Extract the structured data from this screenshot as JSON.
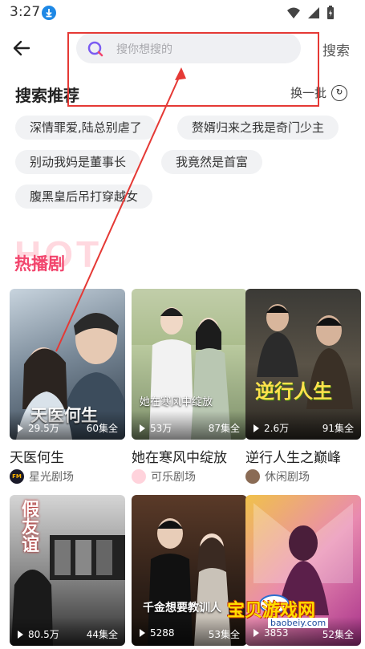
{
  "status_bar": {
    "time": "3:27"
  },
  "search": {
    "placeholder": "搜你想搜的",
    "button_label": "搜索"
  },
  "recommend": {
    "title": "搜索推荐",
    "refresh_label": "换一批",
    "chips": [
      "深情罪爱,陆总别虐了",
      "赘婿归来之我是奇门少主",
      "别动我妈是董事长",
      "我竟然是首富",
      "腹黑皇后吊打穿越女"
    ]
  },
  "hot": {
    "bg_label": "HOT",
    "title": "热播剧"
  },
  "dramas": [
    {
      "title": "天医何生",
      "views": "29.5万",
      "episodes": "60集全",
      "studio": "星光剧场",
      "poster_text": "天医何生"
    },
    {
      "title": "她在寒风中绽放",
      "views": "53万",
      "episodes": "87集全",
      "studio": "可乐剧场",
      "poster_text": "她在寒风中绽放"
    },
    {
      "title": "逆行人生之巅峰",
      "views": "2.6万",
      "episodes": "91集全",
      "studio": "休闲剧场",
      "poster_text": "逆行人生"
    },
    {
      "views": "80.5万",
      "episodes": "44集全",
      "poster_text": "假友谊"
    },
    {
      "views": "5288",
      "episodes": "53集全",
      "poster_text": "千金想要教训人"
    },
    {
      "views": "3853",
      "episodes": "52集全"
    }
  ],
  "watermark": {
    "text": "宝贝游戏网",
    "url": "baobeiy.com"
  },
  "colors": {
    "accent": "#f2456d",
    "search_icon": "#7b5cf2",
    "annotation": "#e53935"
  }
}
